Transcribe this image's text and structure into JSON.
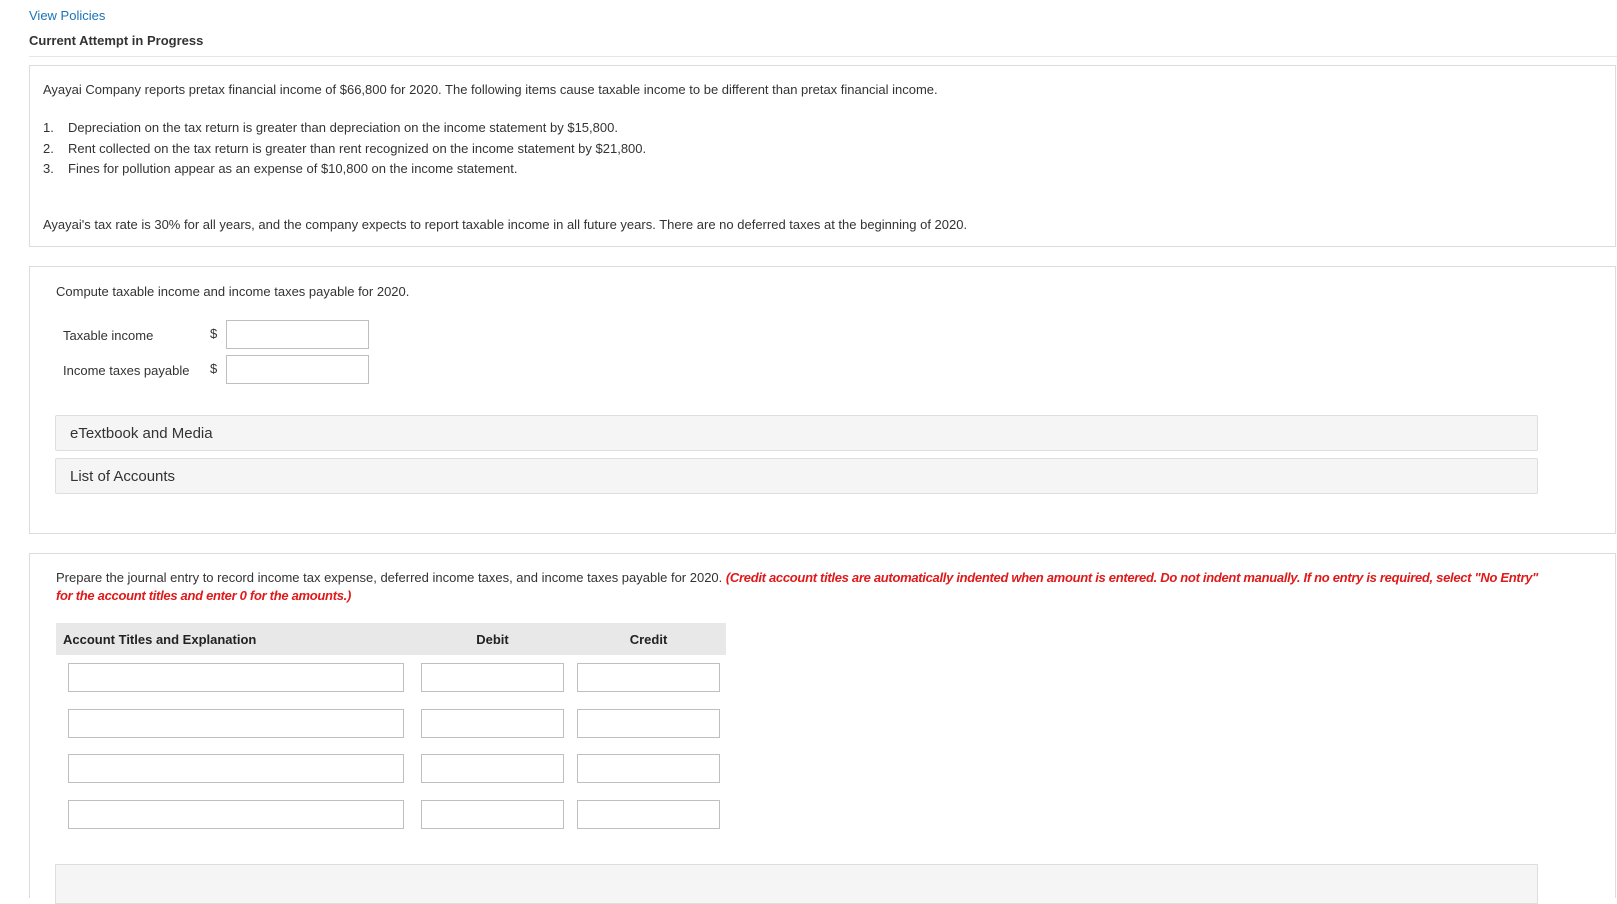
{
  "header": {
    "view_policies": "View Policies",
    "attempt_status": "Current Attempt in Progress"
  },
  "problem": {
    "intro": "Ayayai Company reports pretax financial income of $66,800 for 2020. The following items cause taxable income to be different than pretax financial income.",
    "items": [
      {
        "num": "1.",
        "text": "Depreciation on the tax return is greater than depreciation on the income statement by $15,800."
      },
      {
        "num": "2.",
        "text": "Rent collected on the tax return is greater than rent recognized on the income statement by $21,800."
      },
      {
        "num": "3.",
        "text": "Fines for pollution appear as an expense of $10,800 on the income statement."
      }
    ],
    "closing": "Ayayai's tax rate is 30% for all years, and the company expects to report taxable income in all future years. There are no deferred taxes at the beginning of 2020."
  },
  "question1": {
    "prompt": "Compute taxable income and income taxes payable for 2020.",
    "fields": [
      {
        "label": "Taxable income",
        "currency": "$",
        "value": ""
      },
      {
        "label": "Income taxes payable",
        "currency": "$",
        "value": ""
      }
    ],
    "accordions": [
      "eTextbook and Media",
      "List of Accounts"
    ]
  },
  "question2": {
    "prompt": "Prepare the journal entry to record income tax expense, deferred income taxes, and income taxes payable for 2020.",
    "note": "(Credit account titles are automatically indented when amount is entered. Do not indent manually. If no entry is required, select \"No Entry\" for the account titles and enter 0 for the amounts.)",
    "table": {
      "headers": {
        "account": "Account Titles and Explanation",
        "debit": "Debit",
        "credit": "Credit"
      },
      "rows": [
        {
          "account": "",
          "debit": "",
          "credit": ""
        },
        {
          "account": "",
          "debit": "",
          "credit": ""
        },
        {
          "account": "",
          "debit": "",
          "credit": ""
        },
        {
          "account": "",
          "debit": "",
          "credit": ""
        }
      ]
    }
  },
  "colors": {
    "link": "#1a73b8",
    "note_red": "#e0191a",
    "panel_border": "#dcdcdc",
    "table_header_bg": "#e8e8e8"
  }
}
